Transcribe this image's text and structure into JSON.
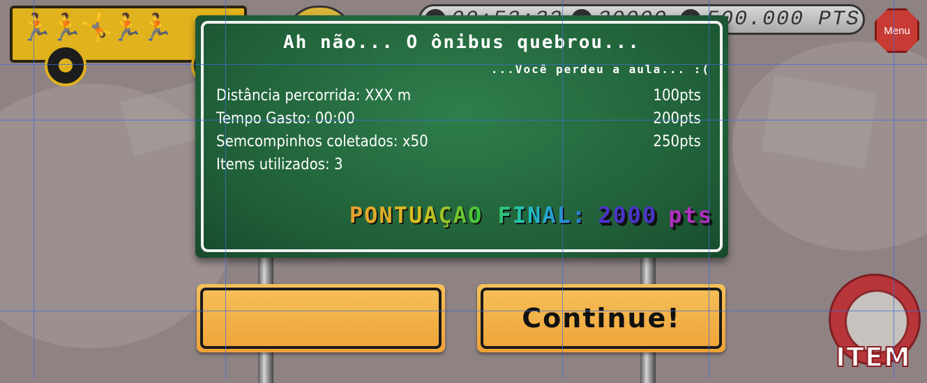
{
  "hud": {
    "time": "00:53:32",
    "distance": "30000",
    "score": "500.000 PTS",
    "menu_label": "Menu"
  },
  "sign": {
    "title": "Ah não... O ônibus quebrou...",
    "subtitle": "...Você perdeu a aula... :(",
    "stats": [
      {
        "label": "Distância percorrida: XXX m",
        "points": "100pts"
      },
      {
        "label": "Tempo Gasto: 00:00",
        "points": "200pts"
      },
      {
        "label": "Semcompinhos coletados: x50",
        "points": "250pts"
      },
      {
        "label": "Items utilizados: 3",
        "points": ""
      }
    ],
    "final_label": "PONTUAÇAO FINAL:",
    "final_value": "2000",
    "final_unit": "pts"
  },
  "buttons": {
    "left_label": "",
    "continue_label": "Continue!"
  },
  "item_button": {
    "label": "ITEM"
  },
  "colors": {
    "sign_green": "#1f5e37",
    "button_orange": "#efa237",
    "item_red": "#b8353a"
  }
}
